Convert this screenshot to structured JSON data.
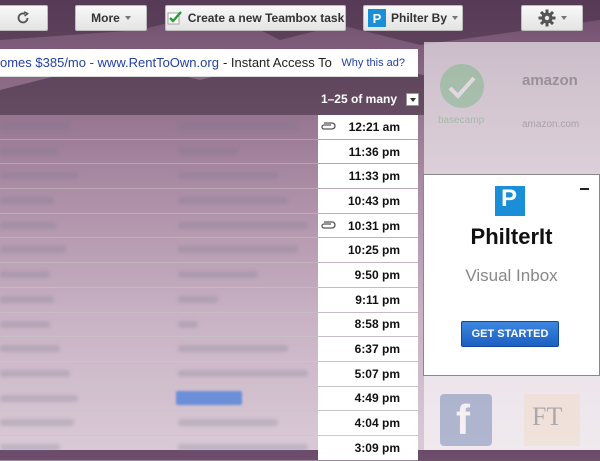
{
  "toolbar": {
    "more_label": "More",
    "teambox_label": "Create a new Teambox task",
    "philter_label": "Philter By"
  },
  "ad": {
    "text": "omes $385/mo - www.RentToOwn.org",
    "text2": "- Instant Access To",
    "why": "Why this ad?"
  },
  "pager": {
    "range": "1–25 of many"
  },
  "messages": [
    {
      "time": "12:21 am",
      "attachment": true
    },
    {
      "time": "11:36 pm",
      "attachment": false
    },
    {
      "time": "11:33 pm",
      "attachment": false
    },
    {
      "time": "10:43 pm",
      "attachment": false
    },
    {
      "time": "10:31 pm",
      "attachment": true
    },
    {
      "time": "10:25 pm",
      "attachment": false
    },
    {
      "time": "9:50 pm",
      "attachment": false
    },
    {
      "time": "9:11 pm",
      "attachment": false
    },
    {
      "time": "8:58 pm",
      "attachment": false
    },
    {
      "time": "6:37 pm",
      "attachment": false
    },
    {
      "time": "5:07 pm",
      "attachment": false
    },
    {
      "time": "4:49 pm",
      "attachment": false
    },
    {
      "time": "4:04 pm",
      "attachment": false
    },
    {
      "time": "3:09 pm",
      "attachment": false
    }
  ],
  "promo": {
    "name": "PhilterIt",
    "subtitle": "Visual Inbox",
    "cta": "GET STARTED",
    "logo_letter": "P"
  },
  "background_tiles": {
    "tile_1": "basecamp",
    "tile_2": "amazon",
    "tile_3": "amazon.com",
    "tile_4": "FT"
  },
  "colors": {
    "accent": "#1a8fd8",
    "link": "#2440a8",
    "cta": "#1b5fc2"
  }
}
